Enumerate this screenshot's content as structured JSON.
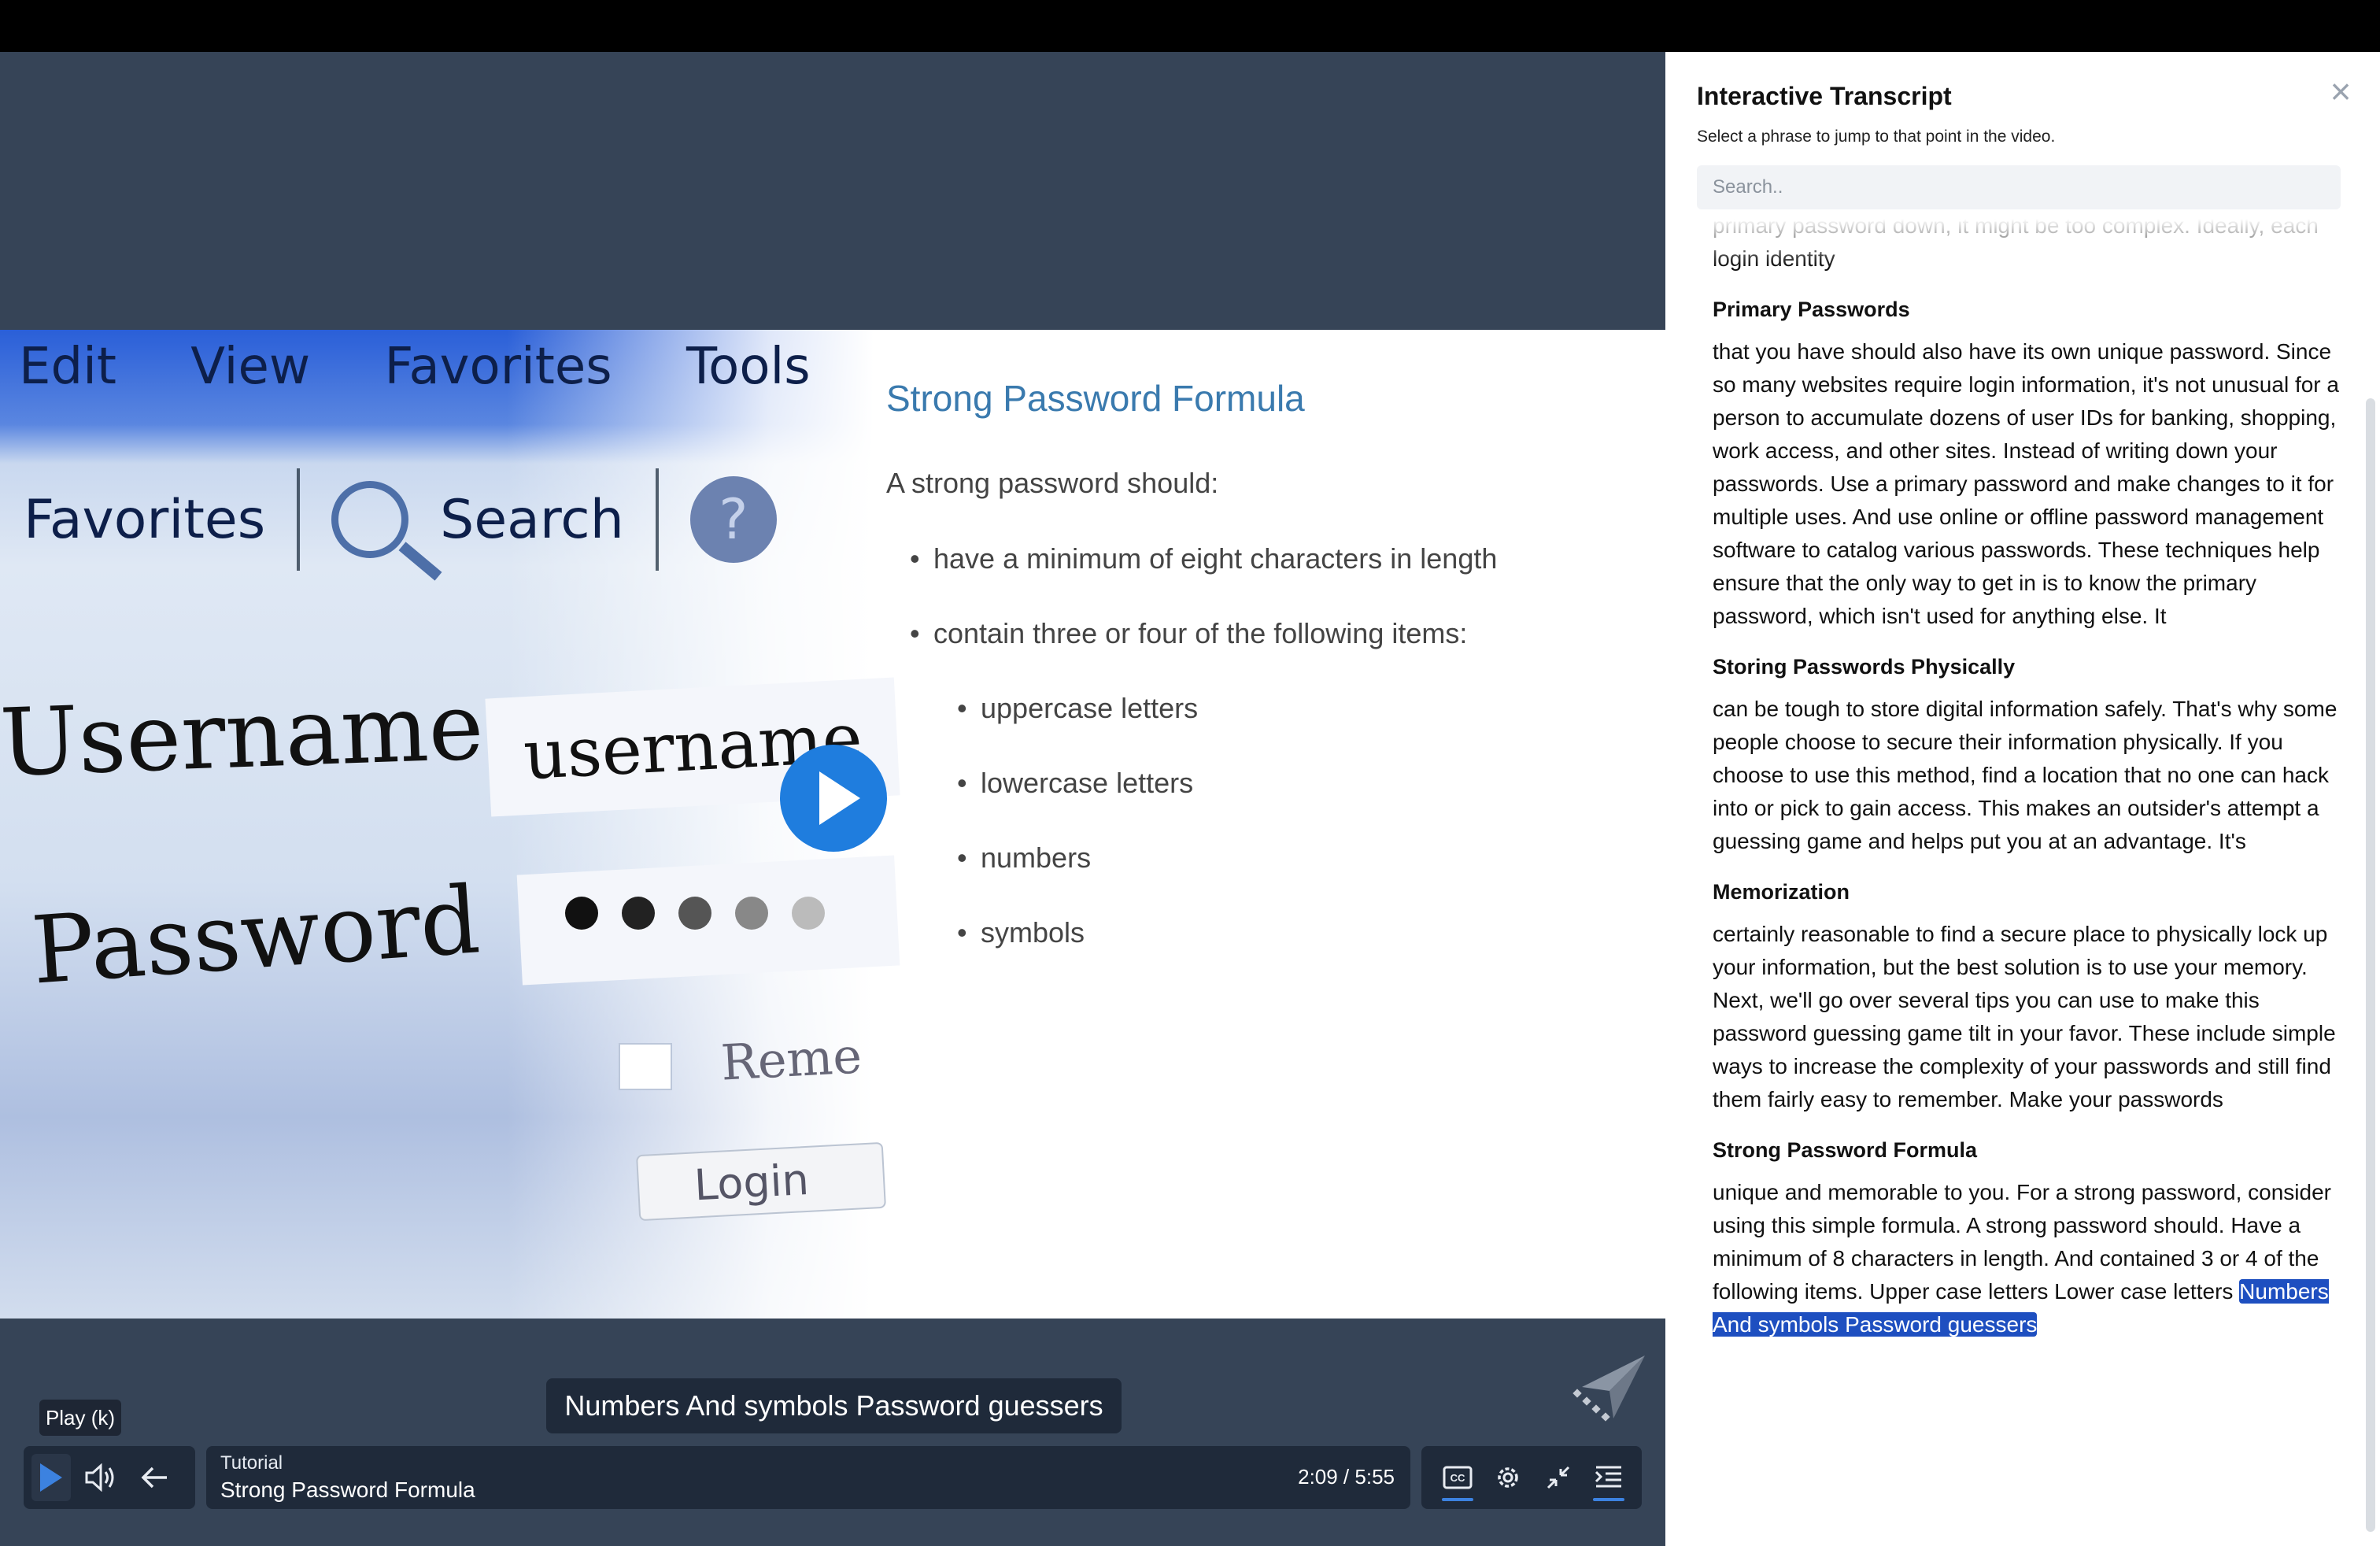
{
  "slide": {
    "photo": {
      "menu": [
        "Edit",
        "View",
        "Favorites",
        "Tools"
      ],
      "toolbar_favorites": "Favorites",
      "toolbar_search": "Search",
      "help_glyph": "?",
      "username_label": "Username",
      "username_value": "username",
      "password_label": "Password",
      "remember_label": "Reme",
      "login_label": "Login"
    },
    "title": "Strong Password Formula",
    "intro": "A strong password should:",
    "bullets": [
      "have a minimum of eight characters in length",
      "contain three or four of the following items:"
    ],
    "sub_bullets": [
      "uppercase letters",
      "lowercase letters",
      "numbers",
      "symbols"
    ]
  },
  "caption": "Numbers And symbols Password guessers",
  "tooltip": "Play (k)",
  "controls": {
    "type_label": "Tutorial",
    "video_title": "Strong Password Formula",
    "time": "2:09 / 5:55",
    "icons": [
      "play-icon",
      "volume-icon",
      "back-arrow-icon",
      "closed-captions-icon",
      "settings-gear-icon",
      "minimize-icon",
      "transcript-icon"
    ]
  },
  "transcript": {
    "title": "Interactive Transcript",
    "subtitle": "Select a phrase to jump to that point in the video.",
    "search_placeholder": "Search..",
    "intro_cut": "primary password down, it might be too complex. Ideally, each login identity",
    "sections": [
      {
        "heading": "Primary Passwords",
        "text": "that you have should also have its own unique password. Since so many websites require login information, it's not unusual for a person to accumulate dozens of user IDs for banking, shopping, work access, and other sites. Instead of writing down your passwords. Use a primary password and make changes to it for multiple uses. And use online or offline password management software to catalog various passwords. These techniques help ensure that the only way to get in is to know the primary password, which isn't used for anything else. It"
      },
      {
        "heading": "Storing Passwords Physically",
        "text": "can be tough to store digital information safely. That's why some people choose to secure their information physically. If you choose to use this method, find a location that no one can hack into or pick to gain access. This makes an outsider's attempt a guessing game and helps put you at an advantage. It's"
      },
      {
        "heading": "Memorization",
        "text": "certainly reasonable to find a secure place to physically lock up your information, but the best solution is to use your memory. Next, we'll go over several tips you can use to make this password guessing game tilt in your favor. These include simple ways to increase the complexity of your passwords and still find them fairly easy to remember. Make your passwords"
      },
      {
        "heading": "Strong Password Formula",
        "text": "unique and memorable to you. For a strong password, consider using this simple formula. A strong password should. Have a minimum of 8 characters in length. And contained 3 or 4 of the following items. Upper case letters Lower case letters",
        "highlight": "Numbers And symbols Password guessers"
      }
    ]
  },
  "colors": {
    "player_bg": "#364457",
    "accent": "#3c82e0",
    "highlight": "#1e4fc0",
    "slide_title": "#3a7aae"
  }
}
